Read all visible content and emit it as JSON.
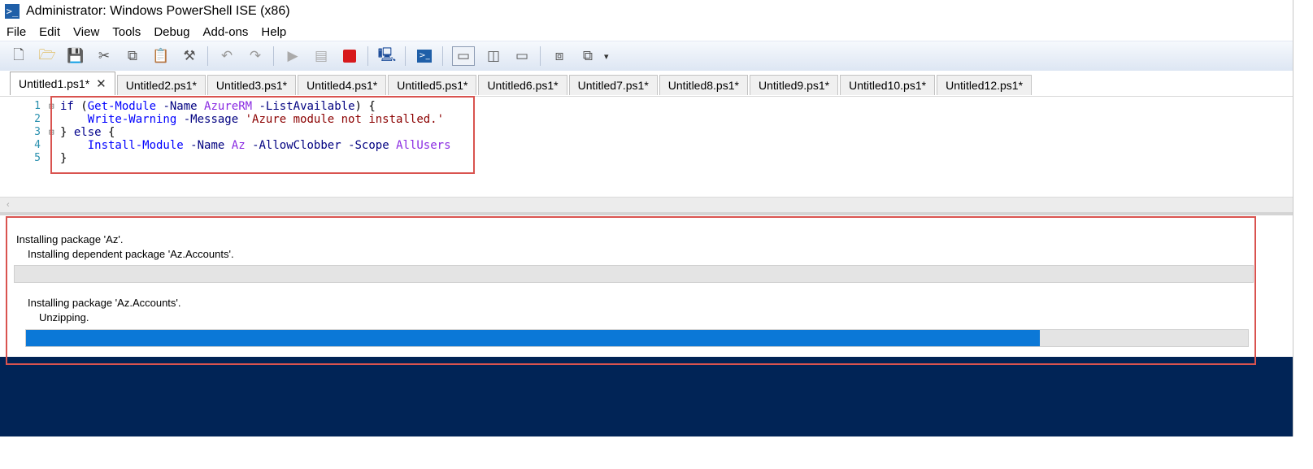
{
  "window": {
    "title": "Administrator: Windows PowerShell ISE (x86)"
  },
  "menu": [
    "File",
    "Edit",
    "View",
    "Tools",
    "Debug",
    "Add-ons",
    "Help"
  ],
  "toolbar": {
    "icons": [
      "new-script-icon",
      "open-icon",
      "save-icon",
      "cut-icon",
      "copy-icon",
      "paste-icon",
      "clear-console-icon",
      "undo-icon",
      "redo-icon",
      "run-script-icon",
      "run-selection-icon",
      "stop-icon",
      "remote-powershell-icon",
      "powershell-console-icon",
      "show-script-top-icon",
      "show-script-right-icon",
      "show-script-max-icon",
      "show-command-window-icon",
      "show-command-addon-icon"
    ]
  },
  "tabs": [
    {
      "label": "Untitled1.ps1*",
      "active": true
    },
    {
      "label": "Untitled2.ps1*"
    },
    {
      "label": "Untitled3.ps1*"
    },
    {
      "label": "Untitled4.ps1*"
    },
    {
      "label": "Untitled5.ps1*"
    },
    {
      "label": "Untitled6.ps1*"
    },
    {
      "label": "Untitled7.ps1*"
    },
    {
      "label": "Untitled8.ps1*"
    },
    {
      "label": "Untitled9.ps1*"
    },
    {
      "label": "Untitled10.ps1*"
    },
    {
      "label": "Untitled12.ps1*"
    }
  ],
  "tab_close_glyph": "✕",
  "editor": {
    "line_numbers": [
      "1",
      "2",
      "3",
      "4",
      "5"
    ],
    "fold_marks": [
      "⊟",
      "",
      "⊟",
      "",
      ""
    ],
    "lines": [
      [
        {
          "t": "if",
          "c": "kw"
        },
        {
          "t": " (",
          "c": ""
        },
        {
          "t": "Get-Module",
          "c": "cmd"
        },
        {
          "t": " ",
          "c": ""
        },
        {
          "t": "-Name",
          "c": "param"
        },
        {
          "t": " ",
          "c": ""
        },
        {
          "t": "AzureRM",
          "c": "cmdarg"
        },
        {
          "t": " ",
          "c": ""
        },
        {
          "t": "-ListAvailable",
          "c": "param"
        },
        {
          "t": ") {",
          "c": ""
        }
      ],
      [
        {
          "t": "    ",
          "c": ""
        },
        {
          "t": "Write-Warning",
          "c": "cmd"
        },
        {
          "t": " ",
          "c": ""
        },
        {
          "t": "-Message",
          "c": "param"
        },
        {
          "t": " ",
          "c": ""
        },
        {
          "t": "'Azure module not installed.'",
          "c": "str"
        }
      ],
      [
        {
          "t": "} ",
          "c": ""
        },
        {
          "t": "else",
          "c": "kw"
        },
        {
          "t": " {",
          "c": ""
        }
      ],
      [
        {
          "t": "    ",
          "c": ""
        },
        {
          "t": "Install-Module",
          "c": "cmd"
        },
        {
          "t": " ",
          "c": ""
        },
        {
          "t": "-Name",
          "c": "param"
        },
        {
          "t": " ",
          "c": ""
        },
        {
          "t": "Az",
          "c": "cmdarg"
        },
        {
          "t": " ",
          "c": ""
        },
        {
          "t": "-AllowClobber",
          "c": "param"
        },
        {
          "t": " ",
          "c": ""
        },
        {
          "t": "-Scope",
          "c": "param"
        },
        {
          "t": " ",
          "c": ""
        },
        {
          "t": "AllUsers",
          "c": "cmdarg"
        }
      ],
      [
        {
          "t": "}",
          "c": ""
        }
      ]
    ]
  },
  "console": {
    "activity1": "Installing package 'Az'.",
    "status1": "Installing dependent package 'Az.Accounts'.",
    "progress1": 0,
    "activity2": "Installing package 'Az.Accounts'.",
    "status2": "Unzipping.",
    "progress2": 0.83
  },
  "colors": {
    "console_bg": "#012456",
    "progress_fill": "#0b78d7",
    "highlight_border": "#d9534f"
  }
}
